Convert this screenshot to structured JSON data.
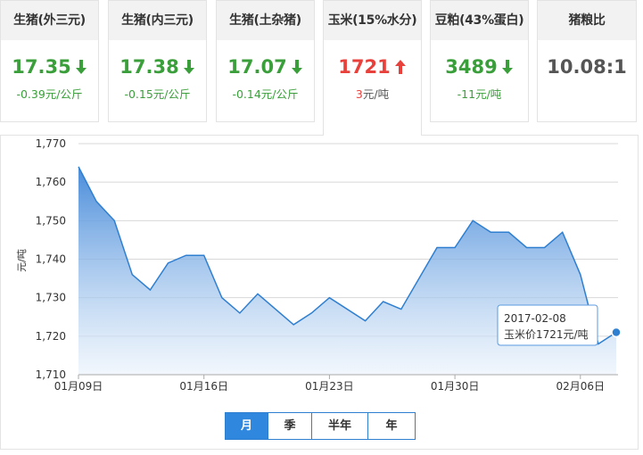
{
  "cards": [
    {
      "title": "生猪(外三元)",
      "price": "17.35",
      "change": "-0.39元/公斤",
      "trend": "down",
      "icon": "arrow-down-icon"
    },
    {
      "title": "生猪(内三元)",
      "price": "17.38",
      "change": "-0.15元/公斤",
      "trend": "down",
      "icon": "arrow-down-icon"
    },
    {
      "title": "生猪(土杂猪)",
      "price": "17.07",
      "change": "-0.14元/公斤",
      "trend": "down",
      "icon": "arrow-down-icon"
    },
    {
      "title": "玉米(15%水分)",
      "price": "1721",
      "change_value": "3",
      "change_unit": "元/吨",
      "trend": "up",
      "icon": "arrow-up-icon",
      "active": true
    },
    {
      "title": "豆粕(43%蛋白)",
      "price": "3489",
      "change": "-11元/吨",
      "trend": "down",
      "icon": "arrow-down-icon"
    },
    {
      "title": "猪粮比",
      "price": "10.08:1",
      "change": "",
      "trend": "none"
    }
  ],
  "colors": {
    "up": "#e8413c",
    "down": "#3a9f3a",
    "line": "#2f7fd1",
    "area_top": "#3f86d8",
    "active_button": "#2f87de"
  },
  "chart_data": {
    "type": "area",
    "ylabel": "元/吨",
    "ylim": [
      1710,
      1770
    ],
    "yticks": [
      "1,710",
      "1,720",
      "1,730",
      "1,740",
      "1,750",
      "1,760",
      "1,770"
    ],
    "xticks": [
      {
        "date": "2017-01-09",
        "label": "01月09日"
      },
      {
        "date": "2017-01-16",
        "label": "01月16日"
      },
      {
        "date": "2017-01-23",
        "label": "01月23日"
      },
      {
        "date": "2017-01-30",
        "label": "01月30日"
      },
      {
        "date": "2017-02-06",
        "label": "02月06日"
      }
    ],
    "grid": true,
    "series": [
      {
        "name": "玉米价",
        "points": [
          [
            "2017-01-09",
            1764
          ],
          [
            "2017-01-10",
            1755
          ],
          [
            "2017-01-11",
            1750
          ],
          [
            "2017-01-12",
            1736
          ],
          [
            "2017-01-13",
            1732
          ],
          [
            "2017-01-14",
            1739
          ],
          [
            "2017-01-15",
            1741
          ],
          [
            "2017-01-16",
            1741
          ],
          [
            "2017-01-17",
            1730
          ],
          [
            "2017-01-18",
            1726
          ],
          [
            "2017-01-19",
            1731
          ],
          [
            "2017-01-21",
            1723
          ],
          [
            "2017-01-22",
            1726
          ],
          [
            "2017-01-23",
            1730
          ],
          [
            "2017-01-25",
            1724
          ],
          [
            "2017-01-26",
            1729
          ],
          [
            "2017-01-27",
            1727
          ],
          [
            "2017-01-29",
            1743
          ],
          [
            "2017-01-30",
            1743
          ],
          [
            "2017-01-31",
            1750
          ],
          [
            "2017-02-01",
            1747
          ],
          [
            "2017-02-02",
            1747
          ],
          [
            "2017-02-03",
            1743
          ],
          [
            "2017-02-04",
            1743
          ],
          [
            "2017-02-05",
            1747
          ],
          [
            "2017-02-06",
            1736
          ],
          [
            "2017-02-07",
            1718
          ],
          [
            "2017-02-08",
            1721
          ]
        ]
      }
    ],
    "tooltip": {
      "date": "2017-02-08",
      "label": "玉米价1721元/吨"
    }
  },
  "range_buttons": [
    {
      "label": "月",
      "selected": true
    },
    {
      "label": "季",
      "selected": false
    },
    {
      "label": "半年",
      "selected": false
    },
    {
      "label": "年",
      "selected": false
    }
  ]
}
